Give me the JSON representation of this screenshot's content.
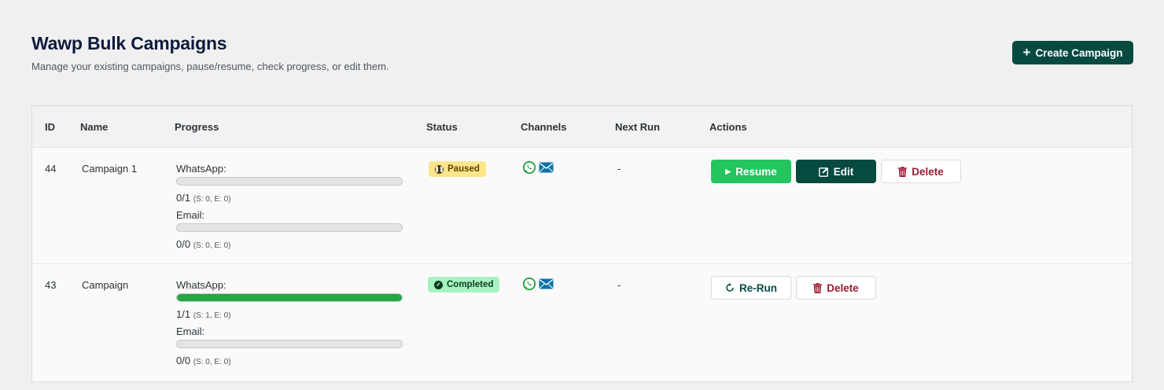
{
  "header": {
    "title": "Wawp Bulk Campaigns",
    "subtitle": "Manage your existing campaigns, pause/resume, check progress, or edit them.",
    "create_label": "Create Campaign"
  },
  "table": {
    "columns": [
      "ID",
      "Name",
      "Progress",
      "Status",
      "Channels",
      "Next Run",
      "Actions"
    ],
    "rows": [
      {
        "id": "44",
        "name": "Campaign 1",
        "whatsapp_label": "WhatsApp:",
        "whatsapp_count": "0/1",
        "whatsapp_detail": "(S: 0, E: 0)",
        "whatsapp_progress": 0,
        "email_label": "Email:",
        "email_count": "0/0",
        "email_detail": "(S: 0, E: 0)",
        "email_progress": 0,
        "status": "Paused",
        "next_run": "-",
        "actions": {
          "resume": "Resume",
          "edit": "Edit",
          "delete": "Delete"
        }
      },
      {
        "id": "43",
        "name": "Campaign",
        "whatsapp_label": "WhatsApp:",
        "whatsapp_count": "1/1",
        "whatsapp_detail": "(S: 1, E: 0)",
        "whatsapp_progress": 1,
        "email_label": "Email:",
        "email_count": "0/0",
        "email_detail": "(S: 0, E: 0)",
        "email_progress": 0,
        "status": "Completed",
        "next_run": "-",
        "actions": {
          "rerun": "Re-Run",
          "delete": "Delete"
        }
      }
    ]
  },
  "colors": {
    "primary": "#064a40",
    "resume": "#22c55e",
    "progress_fill": "#22a745",
    "delete_text": "#9b1c31",
    "whatsapp": "#25a244",
    "email": "#0b73a8"
  },
  "icons": [
    "plus-icon",
    "whatsapp-icon",
    "email-icon",
    "pause-icon",
    "check-icon",
    "play-icon",
    "edit-icon",
    "trash-icon",
    "refresh-icon"
  ]
}
